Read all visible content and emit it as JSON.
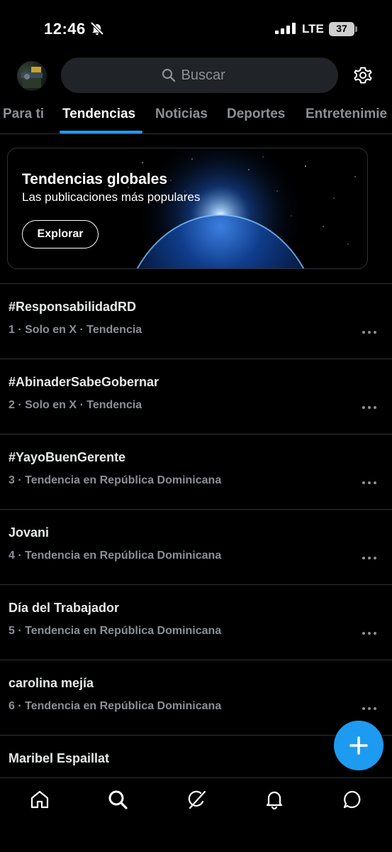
{
  "status": {
    "time": "12:46",
    "network": "LTE",
    "battery": "37"
  },
  "header": {
    "search_placeholder": "Buscar"
  },
  "tabs": [
    {
      "label": "Para ti",
      "active": false
    },
    {
      "label": "Tendencias",
      "active": true
    },
    {
      "label": "Noticias",
      "active": false
    },
    {
      "label": "Deportes",
      "active": false
    },
    {
      "label": "Entretenimie",
      "active": false
    }
  ],
  "banner": {
    "title": "Tendencias globales",
    "subtitle": "Las publicaciones más populares",
    "button": "Explorar"
  },
  "trends": [
    {
      "title": "#ResponsabilidadRD",
      "meta": "1 · Solo en X · Tendencia"
    },
    {
      "title": "#AbinaderSabeGobernar",
      "meta": "2 · Solo en X · Tendencia"
    },
    {
      "title": "#YayoBuenGerente",
      "meta": "3 · Tendencia en República Dominicana"
    },
    {
      "title": "Jovani",
      "meta": "4 · Tendencia en República Dominicana"
    },
    {
      "title": "Día del Trabajador",
      "meta": "5 · Tendencia en República Dominicana"
    },
    {
      "title": "carolina mejía",
      "meta": "6 · Tendencia en República Dominicana"
    },
    {
      "title": "Maribel Espaillat",
      "meta": ""
    }
  ],
  "colors": {
    "accent": "#1d9bf0",
    "background": "#000000",
    "muted_text": "#8b9096",
    "divider": "#2f3336"
  },
  "icons": {
    "status": [
      "bell-off-icon",
      "signal-icon",
      "battery-icon"
    ],
    "header": [
      "avatar",
      "search-icon",
      "gear-icon"
    ],
    "nav": [
      "home-icon",
      "search-icon",
      "grok-icon",
      "bell-icon",
      "messages-icon"
    ],
    "fab": "plus-icon",
    "row": "more-icon"
  }
}
